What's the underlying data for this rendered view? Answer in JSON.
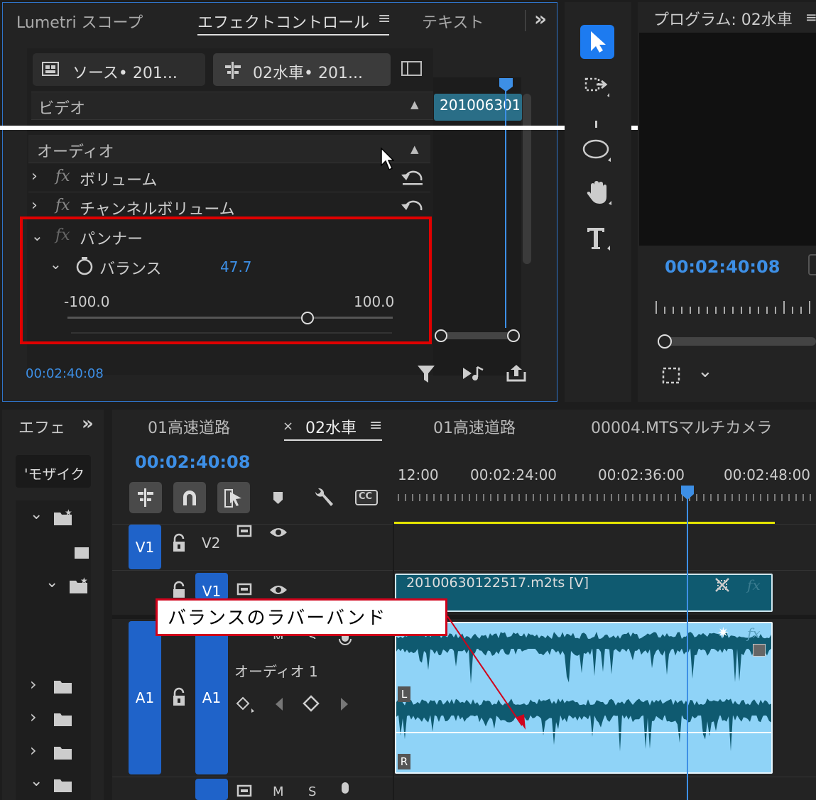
{
  "effect_panel": {
    "tabs": [
      "Lumetri スコープ",
      "エフェクトコントロール",
      "テキスト"
    ],
    "overflow": "»",
    "source_label": "ソース• 201...",
    "sequence_label": "02水車• 201...",
    "clip_name": "201006301",
    "video_section": "ビデオ",
    "audio_section": "オーディオ",
    "effects": [
      "ボリューム",
      "チャンネルボリューム",
      "パンナー"
    ],
    "fx": "fx",
    "balance_label": "バランス",
    "balance_value": "47.7",
    "balance_min": "-100.0",
    "balance_max": "100.0",
    "balance_fraction": 0.7385,
    "timecode": "00:02:40:08"
  },
  "program_panel": {
    "title": "プログラム: 02水車",
    "timecode": "00:02:40:08"
  },
  "project_panel": {
    "title": "エフェ",
    "overflow": "»",
    "search": "'モザイク"
  },
  "timeline": {
    "tabs": [
      "01高速道路",
      "02水車",
      "01高速道路",
      "00004.MTSマルチカメラ"
    ],
    "close": "×",
    "timecode": "00:02:40:08",
    "ruler": [
      "12:00",
      "00:02:24:00",
      "00:02:36:00",
      "00:02:48:00"
    ],
    "cc": "CC",
    "tracks": {
      "v1_src": "V1",
      "v2": "V2",
      "v1": "V1",
      "a1_src": "A1",
      "a1": "A1",
      "audio_name": "オーディオ 1",
      "m": "M",
      "s": "S"
    },
    "video_clip": "20100630122517.m2ts [V]",
    "channel_l": "L",
    "channel_r": "R"
  },
  "callout": {
    "text": "バランスのラバーバンド",
    "border_color": "#d0021b"
  },
  "colors": {
    "accent": "#3d8fe6",
    "highlight_box": "#e00000",
    "audio_clip": "#8fd3f7",
    "video_clip": "#0f5a70"
  }
}
